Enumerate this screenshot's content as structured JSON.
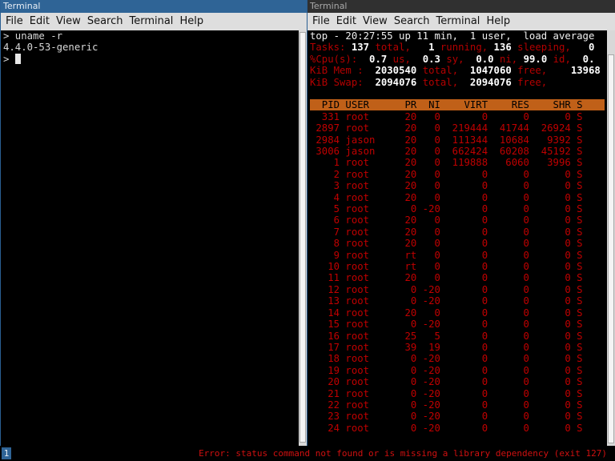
{
  "left_window": {
    "title": "Terminal",
    "menu": [
      "File",
      "Edit",
      "View",
      "Search",
      "Terminal",
      "Help"
    ],
    "lines": [
      "> uname -r",
      "4.4.0-53-generic",
      "> "
    ]
  },
  "right_window": {
    "title": "Terminal",
    "menu": [
      "File",
      "Edit",
      "View",
      "Search",
      "Terminal",
      "Help"
    ],
    "summary": {
      "line1": "top - 20:27:55 up 11 min,  1 user,  load average",
      "tasks": {
        "label": "Tasks:",
        "total": "137",
        "total_l": "total,",
        "running": "1",
        "running_l": "running,",
        "sleeping": "136",
        "sleeping_l": "sleeping,",
        "stopped": "0"
      },
      "cpu": {
        "label": "%Cpu(s):",
        "us": "0.7",
        "us_l": "us,",
        "sy": "0.3",
        "sy_l": "sy,",
        "ni": "0.0",
        "ni_l": "ni,",
        "id": "99.0",
        "id_l": "id,",
        "wa": "0."
      },
      "mem": {
        "label": "KiB Mem :",
        "total": "2030540",
        "total_l": "total,",
        "free": "1047060",
        "free_l": "free,",
        "used": "13968"
      },
      "swap": {
        "label": "KiB Swap:",
        "total": "2094076",
        "total_l": "total,",
        "free": "2094076",
        "free_l": "free,"
      }
    },
    "table_header": "  PID USER      PR  NI    VIRT    RES    SHR S",
    "rows": [
      "  331 root      20   0       0      0      0 S",
      " 2897 root      20   0  219444  41744  26924 S",
      " 2984 jason     20   0  111344  10684   9392 S",
      " 3006 jason     20   0  662424  60208  45192 S",
      "    1 root      20   0  119888   6060   3996 S",
      "    2 root      20   0       0      0      0 S",
      "    3 root      20   0       0      0      0 S",
      "    4 root      20   0       0      0      0 S",
      "    5 root       0 -20       0      0      0 S",
      "    6 root      20   0       0      0      0 S",
      "    7 root      20   0       0      0      0 S",
      "    8 root      20   0       0      0      0 S",
      "    9 root      rt   0       0      0      0 S",
      "   10 root      rt   0       0      0      0 S",
      "   11 root      20   0       0      0      0 S",
      "   12 root       0 -20       0      0      0 S",
      "   13 root       0 -20       0      0      0 S",
      "   14 root      20   0       0      0      0 S",
      "   15 root       0 -20       0      0      0 S",
      "   16 root      25   5       0      0      0 S",
      "   17 root      39  19       0      0      0 S",
      "   18 root       0 -20       0      0      0 S",
      "   19 root       0 -20       0      0      0 S",
      "   20 root       0 -20       0      0      0 S",
      "   21 root       0 -20       0      0      0 S",
      "   22 root       0 -20       0      0      0 S",
      "   23 root       0 -20       0      0      0 S",
      "   24 root       0 -20       0      0      0 S"
    ]
  },
  "statusbar": {
    "workspace": "1",
    "error": "Error: status command not found or is missing a library dependency (exit 127)"
  },
  "colors": {
    "left_title_bg": "#2f6496",
    "right_title_bg": "#303030",
    "top_header_bg": "#c06018",
    "top_text": "#c00000",
    "error_text": "#d01010"
  }
}
